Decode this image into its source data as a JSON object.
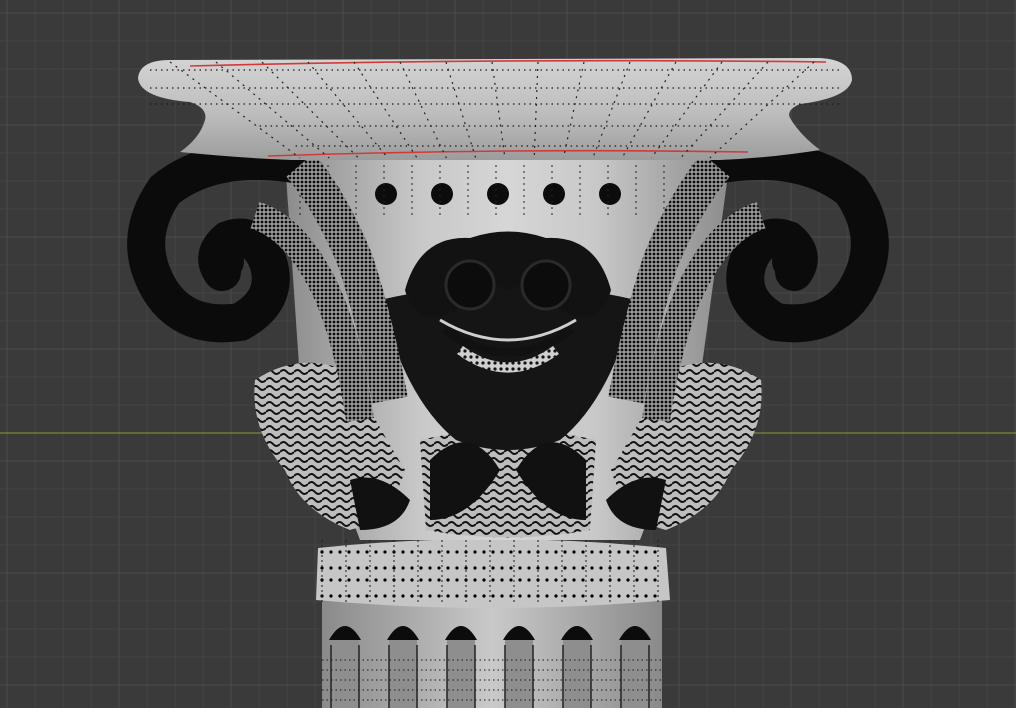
{
  "viewport": {
    "mode": "edit-mode-wireframe-overlay",
    "background_color": "#3a3a3a",
    "grid_minor_color": "#444444",
    "grid_major_color": "#4c4c4c",
    "x_axis_color": "#8a9a3a",
    "mesh_color": "#c4c4c4",
    "mesh_shadow_color": "#8e8e8e",
    "vertex_color": "#000000",
    "selected_edge_color": "#d23a3a"
  },
  "model": {
    "subject": "corinthian-column-capital"
  }
}
